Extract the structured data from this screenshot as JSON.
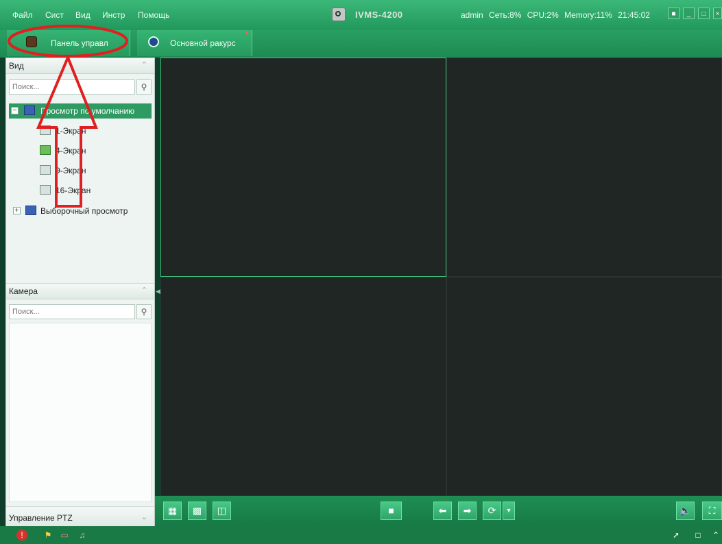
{
  "menu": [
    "Файл",
    "Сист",
    "Вид",
    "Инстр",
    "Помощь"
  ],
  "app_title": "IVMS-4200",
  "status": {
    "user": "admin",
    "network": "Сеть:8%",
    "cpu": "CPU:2%",
    "memory": "Memory:11%",
    "time": "21:45:02"
  },
  "tabs": [
    {
      "label": "Панель управл"
    },
    {
      "label": "Основной ракурс"
    }
  ],
  "view_panel": {
    "title": "Вид",
    "search_placeholder": "Поиск...",
    "tree": [
      {
        "label": "Просмотр по умолчанию",
        "selected": true
      },
      {
        "label": "1-Экран"
      },
      {
        "label": "4-Экран"
      },
      {
        "label": "9-Экран"
      },
      {
        "label": "16-Экран"
      },
      {
        "label": "Выборочный просмотр"
      }
    ]
  },
  "camera_panel": {
    "title": "Камера",
    "search_placeholder": "Поиск..."
  },
  "ptz_panel": {
    "title": "Управление PTZ"
  },
  "colors": {
    "accent": "#2f9a62",
    "annotation": "#e02020"
  }
}
